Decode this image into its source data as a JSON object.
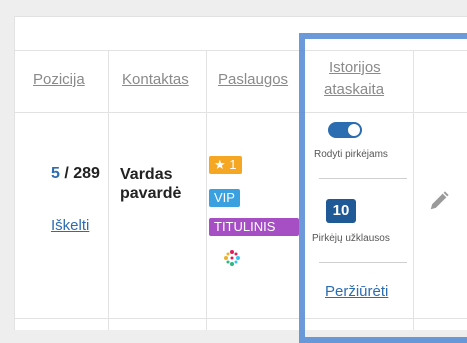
{
  "table": {
    "headers": {
      "position": "Pozicija",
      "contact": "Kontaktas",
      "services": "Paslaugos",
      "history_line1": "Istorijos",
      "history_line2": "ataskaita"
    },
    "row": {
      "position_current": "5",
      "position_total": " / 289",
      "lift_link": "Iškelti",
      "contact_line1": "Vardas",
      "contact_line2": "pavardė",
      "badges": {
        "star_count": "1",
        "vip": "VIP",
        "titled": "TITULINIS"
      },
      "history": {
        "toggle_label": "Rodyti pirkėjams",
        "toggle_on": true,
        "inquiry_count": "10",
        "inquiry_label": "Pirkėjų užklausos",
        "view_link": "Peržiūrėti"
      }
    }
  },
  "colors": {
    "link": "#2c6cb0",
    "star_badge": "#f5a623",
    "vip_badge": "#3aa0e0",
    "titled_badge": "#a64fc4",
    "highlight": "#5b8fd6"
  },
  "icons": [
    "star-icon",
    "pencil-icon",
    "slack-like-icon"
  ]
}
